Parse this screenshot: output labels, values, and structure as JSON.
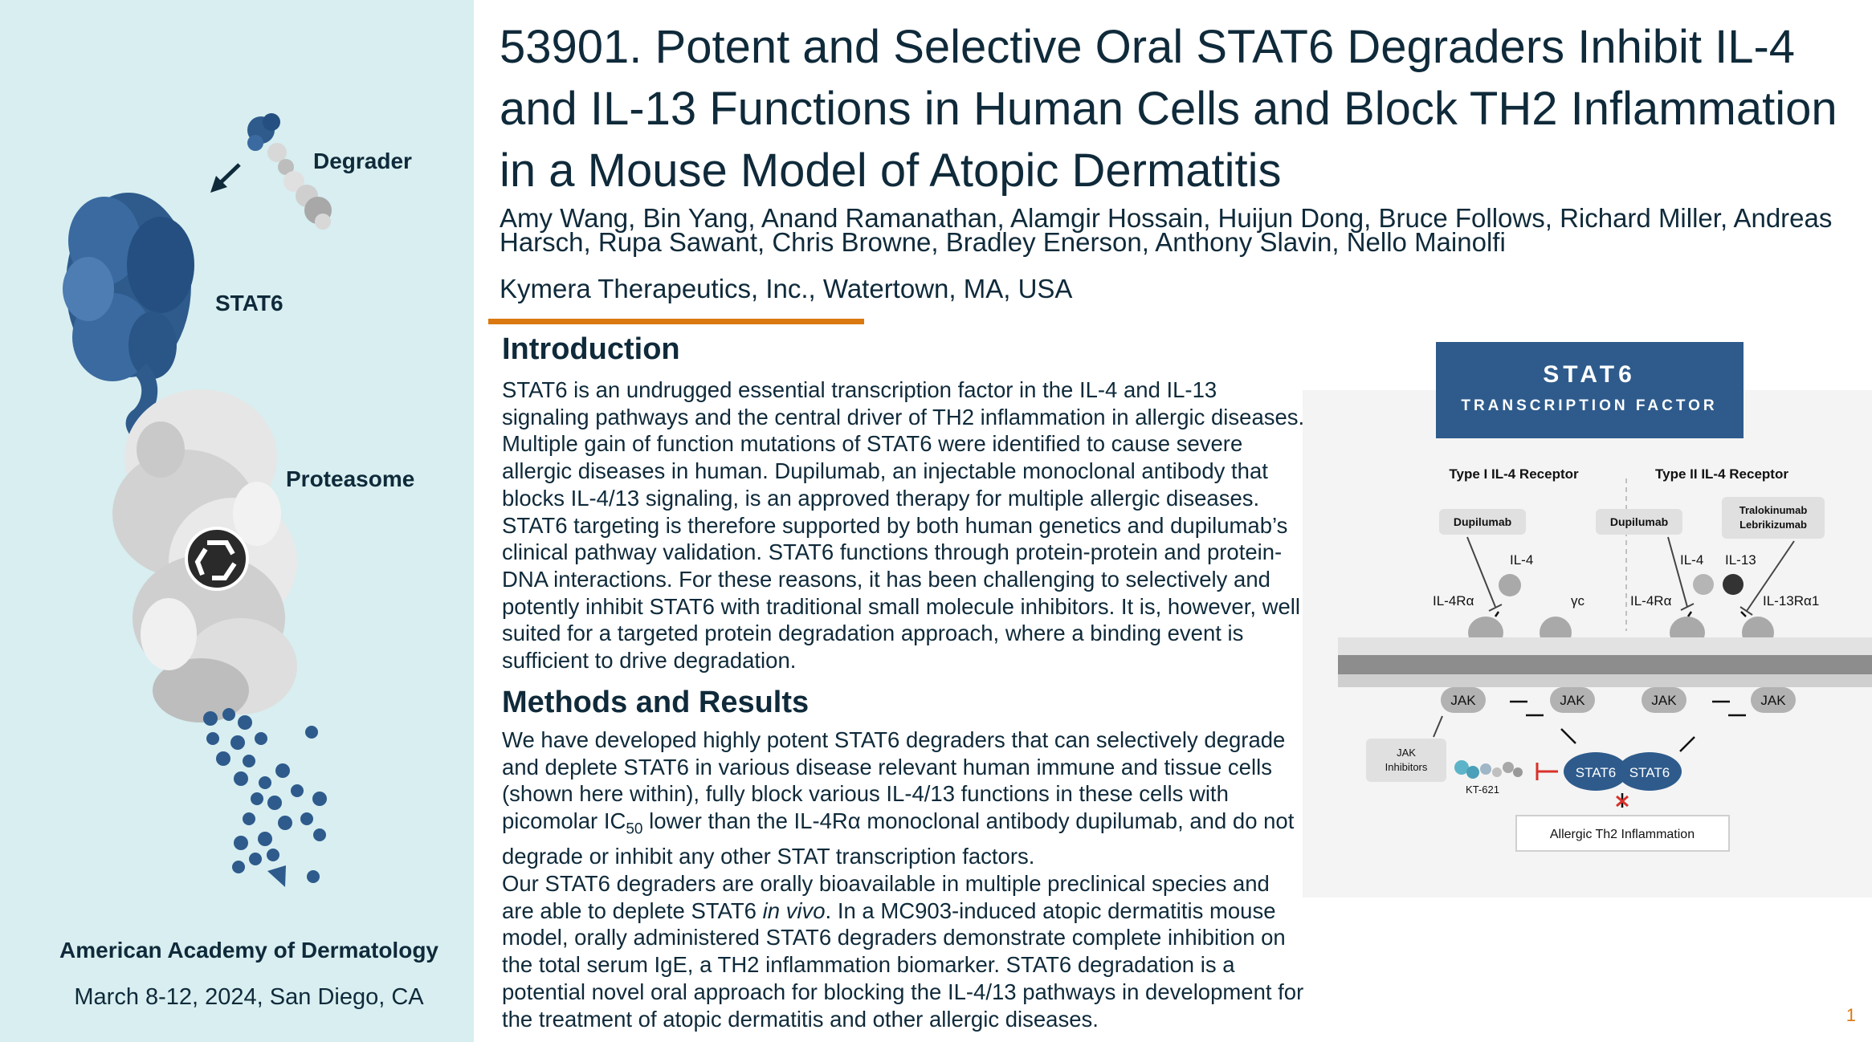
{
  "left_panel": {
    "labels": {
      "degrader": "Degrader",
      "stat6": "STAT6",
      "proteasome": "Proteasome"
    },
    "conference": {
      "name": "American Academy of Dermatology",
      "date": "March 8-12, 2024, San Diego, CA"
    }
  },
  "header": {
    "title": "53901. Potent and Selective Oral STAT6 Degraders Inhibit IL-4 and IL-13 Functions in Human Cells and Block TH2 Inflammation in a Mouse Model of Atopic Dermatitis",
    "authors": "Amy Wang, Bin Yang, Anand Ramanathan, Alamgir Hossain, Huijun Dong, Bruce Follows, Richard Miller, Andreas Harsch, Rupa Sawant, Chris Browne, Bradley Enerson, Anthony Slavin, Nello Mainolfi",
    "affiliation": "Kymera Therapeutics, Inc., Watertown, MA, USA"
  },
  "introduction": {
    "heading": "Introduction",
    "body": "STAT6 is an undrugged essential transcription factor in the IL-4 and IL-13 signaling pathways and the central driver of TH2 inflammation in allergic diseases. Multiple gain of function mutations of STAT6 were identified to cause severe allergic diseases in human. Dupilumab, an injectable monoclonal antibody that blocks IL-4/13 signaling, is an approved therapy for multiple allergic diseases. STAT6 targeting is therefore supported by both human genetics and dupilumab’s clinical pathway validation. STAT6 functions through protein-protein and protein-DNA interactions. For these reasons, it has been challenging to selectively and potently inhibit STAT6 with traditional small molecule inhibitors. It is, however, well suited for a targeted protein degradation approach, where a binding event is sufficient to drive degradation."
  },
  "methods": {
    "heading": "Methods and Results",
    "p1_a": "We have developed highly potent STAT6 degraders that can selectively degrade and deplete STAT6 in various disease relevant human immune and tissue cells (shown here within), fully block various IL-4/13 functions in these cells with picomolar IC",
    "p1_sub": "50",
    "p1_b": " lower than the IL-4Rα monoclonal antibody dupilumab, and do not degrade or inhibit any other STAT transcription factors.",
    "p2_a": "Our STAT6 degraders are orally bioavailable in multiple preclinical species and are able to deplete STAT6 ",
    "p2_em": "in vivo",
    "p2_b": ". In a MC903-induced atopic dermatitis mouse model, orally administered STAT6 degraders demonstrate complete inhibition on the total serum IgE, a TH2 inflammation biomarker. STAT6 degradation is a potential novel oral approach for blocking the IL-4/13 pathways in development for the treatment of atopic dermatitis and other allergic diseases."
  },
  "diagram": {
    "banner_title": "STAT6",
    "banner_subtitle": "TRANSCRIPTION FACTOR",
    "type1_label": "Type I IL-4 Receptor",
    "type2_label": "Type II IL-4 Receptor",
    "dupilumab_1": "Dupilumab",
    "dupilumab_2": "Dupilumab",
    "tralokinumab": "Tralokinumab",
    "lebrikizumab": "Lebrikizumab",
    "il4_1": "IL-4",
    "il4_2": "IL-4",
    "il13": "IL-13",
    "il4ra_1": "IL-4Rα",
    "il4ra_2": "IL-4Rα",
    "gamma_c": "γc",
    "il13ra1": "IL-13Rα1",
    "jak_1": "JAK",
    "jak_2": "JAK",
    "jak_3": "JAK",
    "jak_4": "JAK",
    "jak_inhibitors_1": "JAK",
    "jak_inhibitors_2": "Inhibitors",
    "kt_label": "KT-621",
    "stat6_left": "STAT6",
    "stat6_right": "STAT6",
    "outcome": "Allergic Th2 Inflammation"
  },
  "page_number": "1",
  "colors": {
    "accent_orange": "#d9790f",
    "navy": "#2e5b8c",
    "panel_bg": "#d8eef0",
    "text": "#0f2a3a"
  }
}
